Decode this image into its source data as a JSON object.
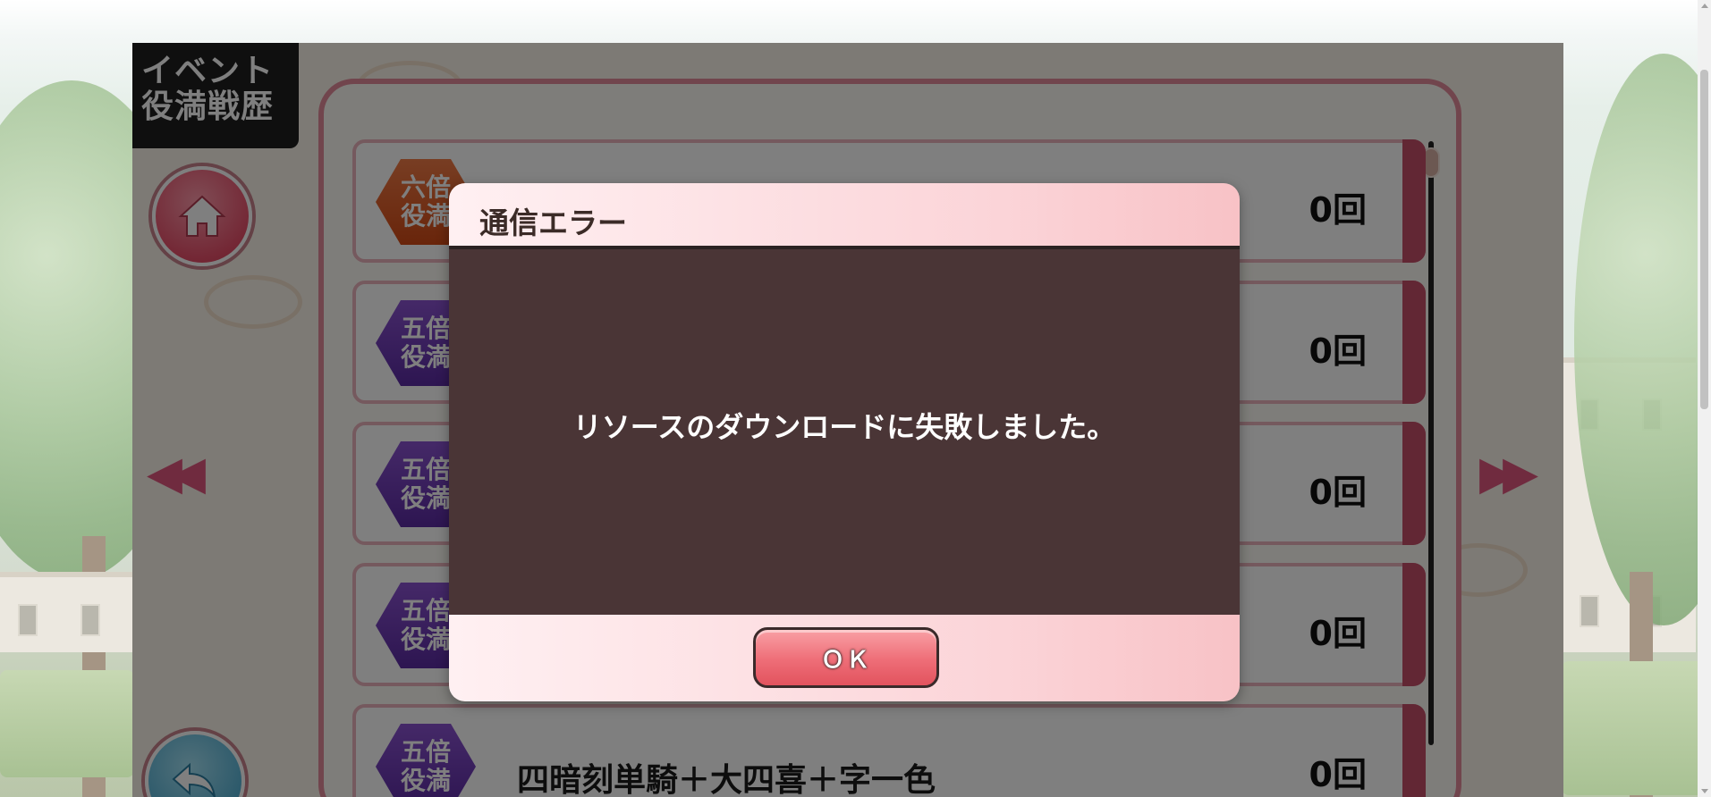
{
  "screen": {
    "title_line1": "イベント",
    "title_line2": "役満戦歴"
  },
  "navigation": {
    "home_icon": "home-icon",
    "back_icon": "back-arrow-icon",
    "prev_page": "◀◀",
    "next_page": "▶▶"
  },
  "yakuman_list": [
    {
      "badge_line1": "六倍",
      "badge_line2": "役満",
      "badge_color": "#e0642c",
      "name": "",
      "count": "0回"
    },
    {
      "badge_line1": "五倍",
      "badge_line2": "役満",
      "badge_color": "#6a36b8",
      "name": "",
      "count": "0回"
    },
    {
      "badge_line1": "五倍",
      "badge_line2": "役満",
      "badge_color": "#6a36b8",
      "name": "",
      "count": "0回"
    },
    {
      "badge_line1": "五倍",
      "badge_line2": "役満",
      "badge_color": "#6a36b8",
      "name": "",
      "count": "0回"
    },
    {
      "badge_line1": "五倍",
      "badge_line2": "役満",
      "badge_color": "#6a36b8",
      "name": "四暗刻単騎＋大四喜＋字一色",
      "count": "0回"
    }
  ],
  "dialog": {
    "title": "通信エラー",
    "message": "リソースのダウンロードに失敗しました。",
    "ok_label": "ＯＫ"
  },
  "colors": {
    "accent_pink": "#e28a9a",
    "dialog_body": "#4a3536",
    "ok_button": "#ee6d77"
  }
}
